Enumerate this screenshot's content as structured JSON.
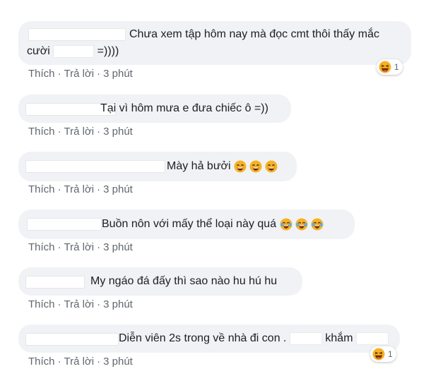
{
  "actions": {
    "like": "Thích",
    "reply": "Trả lời",
    "separator": "·",
    "time": "3 phút"
  },
  "colors": {
    "bubble": "#f0f2f5",
    "text": "#1c1e21",
    "meta": "#606770",
    "emoji_face": "#f7b125"
  },
  "comments": [
    {
      "line1": "Chưa xem tập hôm nay mà đọc cmt thôi thấy mắc",
      "line2_start": "cười",
      "line2_end": "=))))",
      "reaction": {
        "icon": "laughing-emoji-icon",
        "count": "1"
      }
    },
    {
      "text": "Tại vì hôm mưa e đưa chiếc ô =))"
    },
    {
      "text": "Mày hả bưởi",
      "emoji": "smiling-emoji-icon",
      "emoji_count": 3
    },
    {
      "text": "Buồn nôn với mấy thể loại này quá",
      "emoji": "crying-laughing-emoji-icon",
      "emoji_count": 3
    },
    {
      "text": "My ngáo đá đấy thì sao nào hu hú hu"
    },
    {
      "text_start": "Diễn viên 2s trong về nhà đi con .",
      "text_mid": "khắm",
      "reaction": {
        "icon": "laughing-emoji-icon",
        "count": "1"
      }
    }
  ]
}
